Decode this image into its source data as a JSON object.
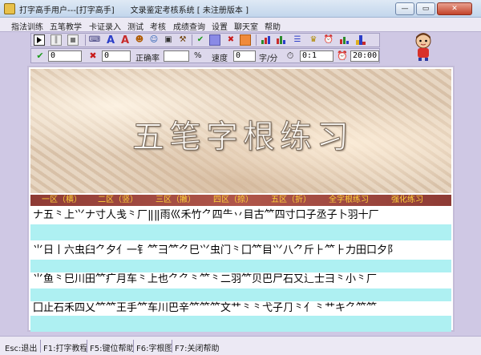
{
  "window": {
    "title": "打字高手用户---[打字高手]　　文录鉴定考核系统 [ 未注册版本 ]",
    "min_label": "—",
    "max_label": "▭",
    "close_label": "✕"
  },
  "menu": [
    "指法训练",
    "五笔教学",
    "卡证录入",
    "测试",
    "考核",
    "成绩查询",
    "设置",
    "聊天室",
    "帮助"
  ],
  "stats": {
    "correct_count": "0",
    "error_count": "0",
    "accuracy_label": "正确率",
    "accuracy_value": "",
    "percent_label": "%",
    "speed_label": "速度",
    "speed_value": "0",
    "speed_unit": "字/分",
    "elapsed_time": "0:1",
    "clock_time": "20:00"
  },
  "banner": {
    "title": "五笔字根练习"
  },
  "zones": [
    "一区（横）",
    "二区（竖）",
    "三区（撇）",
    "四区（捺）",
    "五区（折）",
    "全字根练习",
    "强化练习"
  ],
  "practice_rows": [
    "ナ五⺀上⺍ナ寸人戋⺀厂‖‖雨巛禾竹⺈四⺧丷目古⺮四寸口子丞子卜羽十厂",
    "⺌日丨六虫臼⺈夕⺅一钅⺮⺕⺮⺈巳⺍虫门⺀囗⺮目⺍八⺈斤⺊⺮⺊力田口夕阝",
    "⺌鱼⺀巳川田⺮疒月车⺀上也⺈⺈⺀⺮⺀二羽⺮贝巴尸石又辶士⺕⺀小⺀厂",
    "囗止石禾四乂⺮⺮王手⺮车川巴辛⺮⺮⺮文⺾⺀⺀弋子⺆⺀⺅⺀⺾キ⺈⺮⺮"
  ],
  "statusbar": [
    "Esc:退出",
    "F1:打字教程",
    "F5:键位帮助",
    "F6:字根图",
    "F7:关闭帮助"
  ],
  "icons": {
    "toolbar": [
      "play-icon",
      "pause-icon",
      "stop-icon",
      "typewriter-icon",
      "font-a-icon",
      "font-a-alt-icon",
      "people-icon",
      "users-icon",
      "disk-icon",
      "tool-icon",
      "check-icon",
      "square-blue-icon",
      "cross-icon",
      "square-orange-icon",
      "chart-icon",
      "chart-alt-icon",
      "list-icon",
      "trophy-icon",
      "alarm-icon",
      "graph-icon",
      "pedestal-icon"
    ]
  },
  "colors": {
    "accent_teal": "#aef0f2",
    "zone_bar": "#8e3b35",
    "zone_text": "#ffd23a"
  }
}
